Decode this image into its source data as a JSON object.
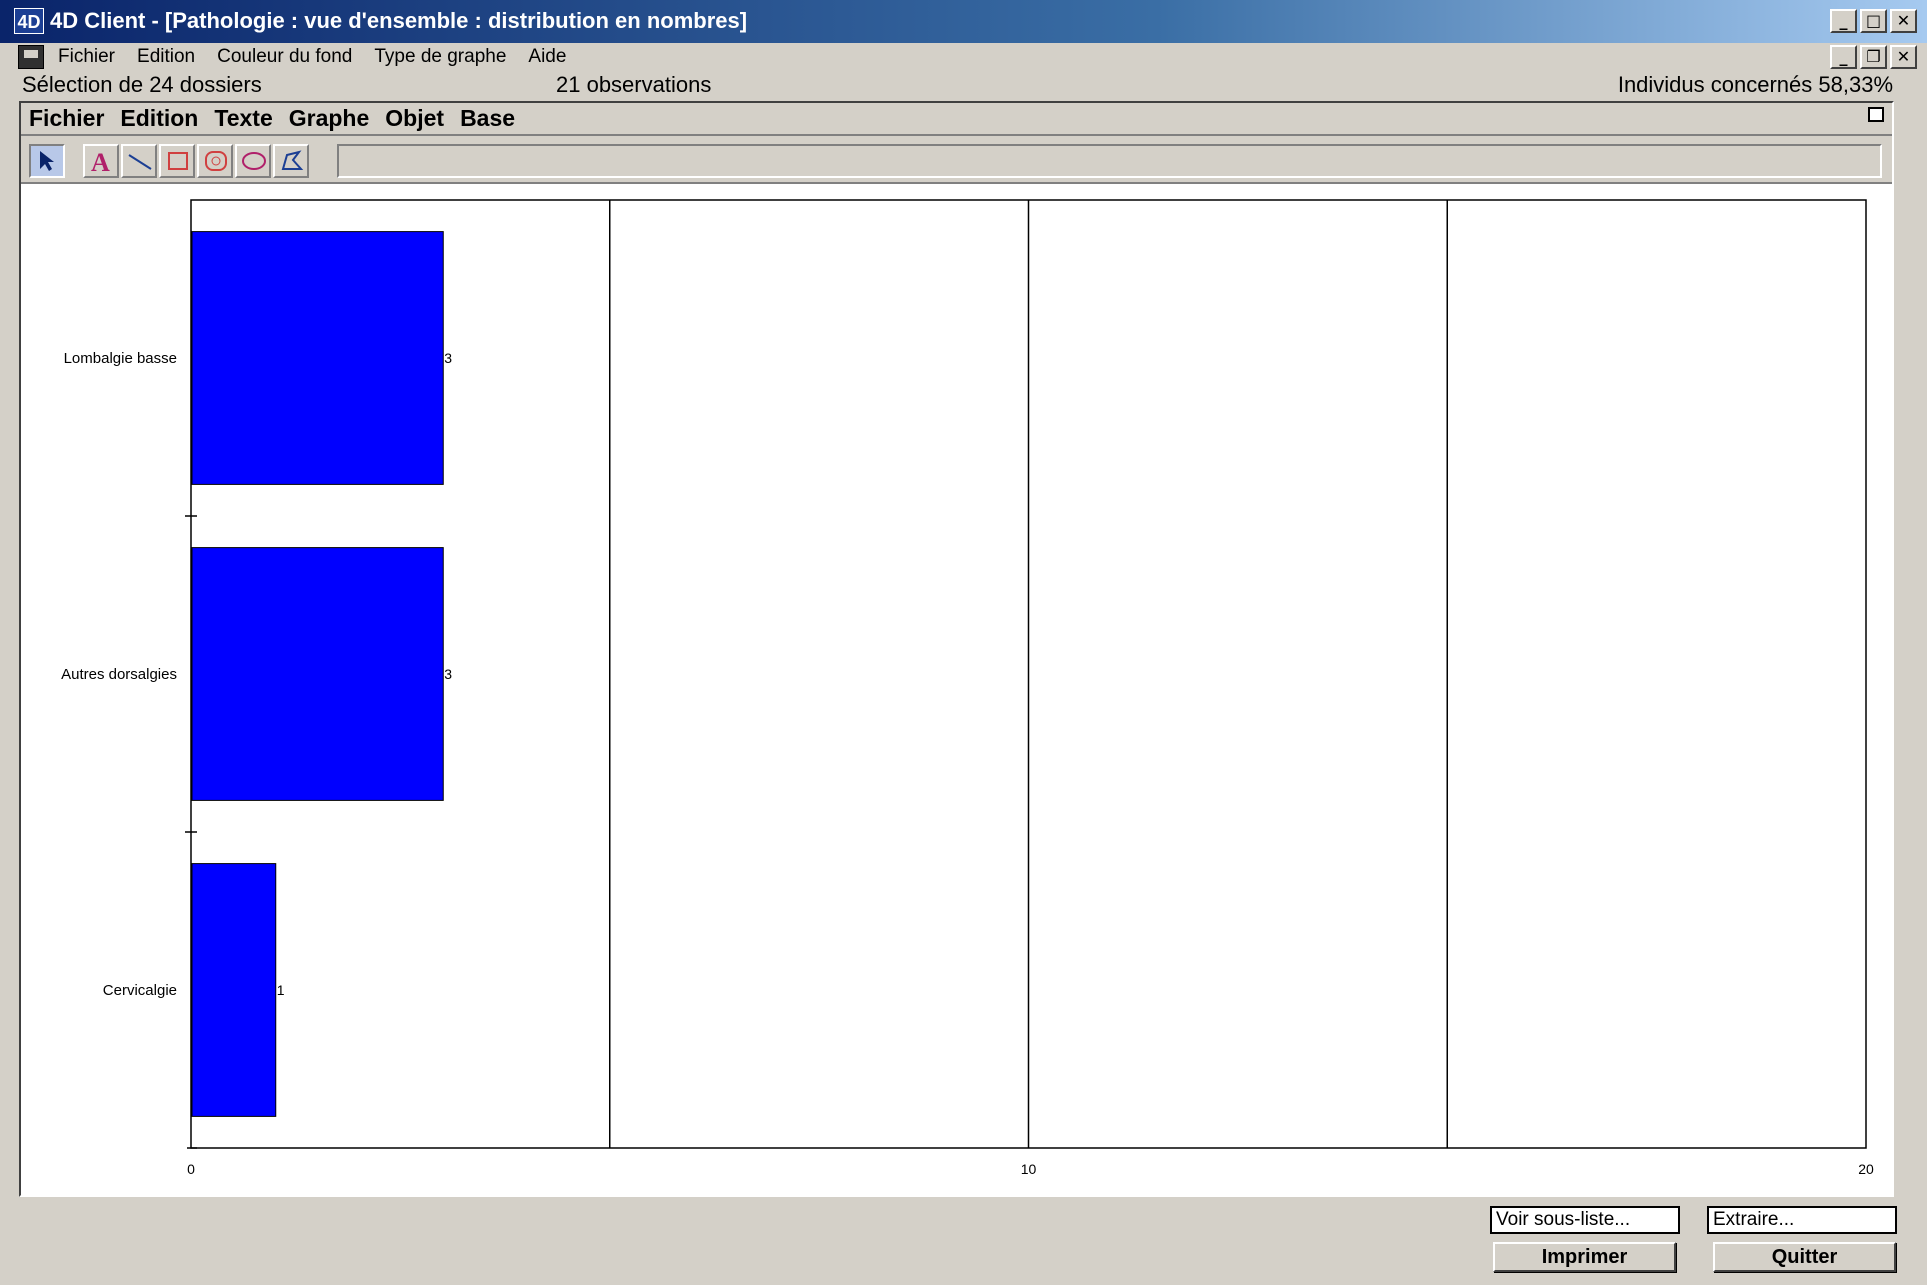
{
  "window": {
    "app_icon": "4D",
    "title": "4D Client - [Pathologie : vue d'ensemble : distribution en nombres]",
    "buttons": {
      "minimize": "_",
      "maximize": "□",
      "close": "✕",
      "restore": "❐"
    }
  },
  "menubar": {
    "items": [
      "Fichier",
      "Edition",
      "Couleur du fond",
      "Type de graphe",
      "Aide"
    ]
  },
  "info": {
    "selection": "Sélection de 24 dossiers",
    "observations": "21 observations",
    "individus": "Individus concernés 58,33%"
  },
  "graph_window": {
    "menu": [
      "Fichier",
      "Edition",
      "Texte",
      "Graphe",
      "Objet",
      "Base"
    ],
    "tools": [
      "arrow-icon",
      "text-icon",
      "line-icon",
      "rectangle-icon",
      "rounded-rectangle-icon",
      "oval-icon",
      "polygon-icon"
    ]
  },
  "chart_data": {
    "type": "bar",
    "orientation": "horizontal",
    "categories": [
      "Lombalgie basse",
      "Autres dorsalgies",
      "Cervicalgie"
    ],
    "values": [
      3,
      3,
      1
    ],
    "value_labels": [
      "3",
      "3",
      "1"
    ],
    "xlim": [
      0,
      20
    ],
    "x_tick_labels": [
      "0",
      "10",
      "20"
    ],
    "grid": true,
    "bar_color": "#0000ff"
  },
  "footer": {
    "voir_sous_liste": "Voir sous-liste...",
    "extraire": "Extraire...",
    "imprimer": "Imprimer",
    "quitter": "Quitter"
  }
}
